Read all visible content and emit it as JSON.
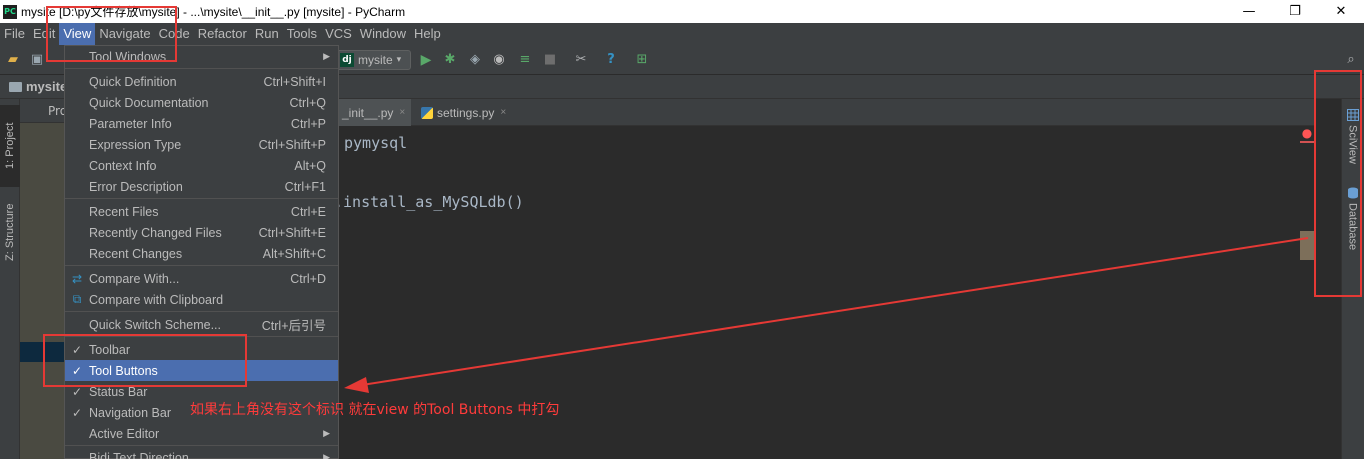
{
  "window": {
    "app_icon_label": "PC",
    "title": "mysite [D:\\py文件存放\\mysite] - ...\\mysite\\__init__.py [mysite] - PyCharm",
    "minimize": "—",
    "maximize": "❐",
    "close": "✕"
  },
  "menubar": {
    "items": [
      "File",
      "Edit",
      "View",
      "Navigate",
      "Code",
      "Refactor",
      "Run",
      "Tools",
      "VCS",
      "Window",
      "Help"
    ],
    "active": "View"
  },
  "toolbar": {
    "run_config_icon": "dj",
    "run_config": "mysite",
    "run_config_arrow": "▾"
  },
  "navbar": {
    "breadcrumb": "mysite"
  },
  "left_stripe": {
    "project_tab": "1: Project",
    "structure_tab": "Z: Structure"
  },
  "project_panel": {
    "header": "Pro"
  },
  "editor": {
    "tabs": [
      {
        "label": "_init__.py",
        "active": true
      },
      {
        "label": "settings.py",
        "active": false
      }
    ],
    "close_glyph": "×",
    "lines": [
      "pymysql",
      ".install_as_MySQLdb()"
    ]
  },
  "right_stripe": {
    "sciview_tab": "SciView",
    "database_tab": "Database"
  },
  "view_menu": {
    "items": [
      {
        "label": "Tool Windows",
        "shortcut": "",
        "submenu": true
      },
      {
        "label": "Quick Definition",
        "shortcut": "Ctrl+Shift+I"
      },
      {
        "label": "Quick Documentation",
        "shortcut": "Ctrl+Q"
      },
      {
        "label": "Parameter Info",
        "shortcut": "Ctrl+P"
      },
      {
        "label": "Expression Type",
        "shortcut": "Ctrl+Shift+P"
      },
      {
        "label": "Context Info",
        "shortcut": "Alt+Q"
      },
      {
        "label": "Error Description",
        "shortcut": "Ctrl+F1"
      },
      {
        "label": "Recent Files",
        "shortcut": "Ctrl+E"
      },
      {
        "label": "Recently Changed Files",
        "shortcut": "Ctrl+Shift+E"
      },
      {
        "label": "Recent Changes",
        "shortcut": "Alt+Shift+C"
      },
      {
        "label": "Compare With...",
        "shortcut": "Ctrl+D"
      },
      {
        "label": "Compare with Clipboard",
        "shortcut": ""
      },
      {
        "label": "Quick Switch Scheme...",
        "shortcut": "Ctrl+后引号"
      },
      {
        "label": "Toolbar",
        "shortcut": "",
        "checked": true
      },
      {
        "label": "Tool Buttons",
        "shortcut": "",
        "checked": true,
        "selected": true
      },
      {
        "label": "Status Bar",
        "shortcut": "",
        "checked": true
      },
      {
        "label": "Navigation Bar",
        "shortcut": "",
        "checked": true
      },
      {
        "label": "Active Editor",
        "shortcut": "",
        "submenu": true
      },
      {
        "label": "Bidi Text Direction",
        "shortcut": "",
        "submenu": true
      }
    ],
    "check_glyph": "✓",
    "submenu_glyph": "▶"
  },
  "annotation": {
    "text": "如果右上角没有这个标识  就在view  的Tool Buttons 中打勾",
    "color": "#e53935"
  },
  "colors": {
    "accent": "#4b6eaf",
    "background": "#2b2b2b",
    "panel": "#3c3f41",
    "annotation_red": "#e53935"
  }
}
